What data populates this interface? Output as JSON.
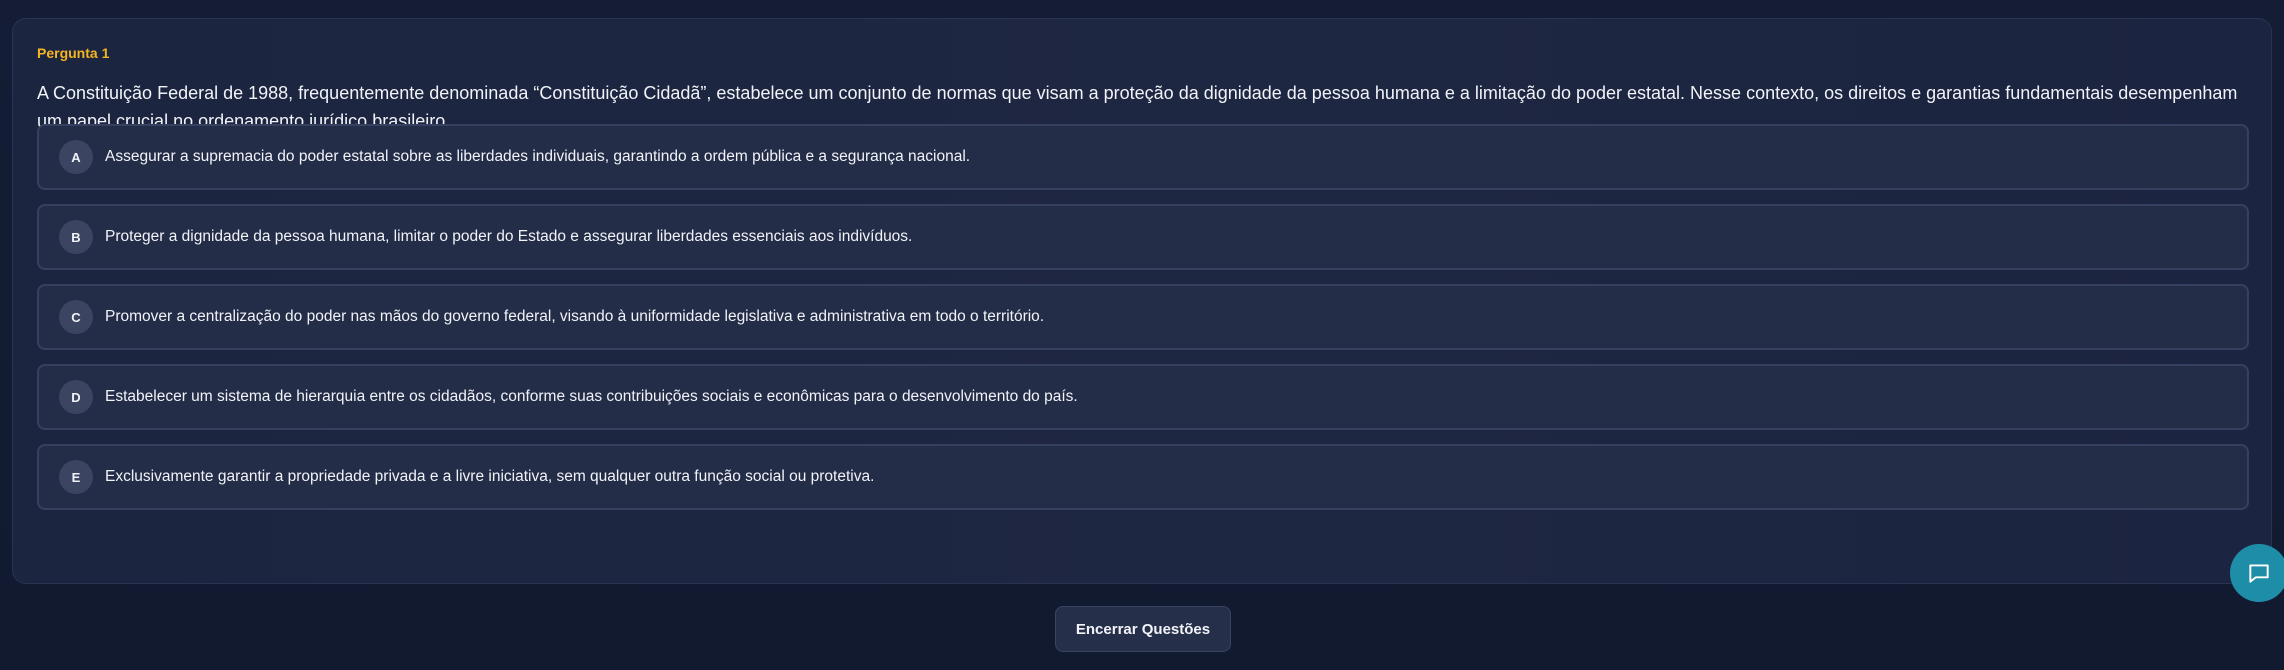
{
  "question": {
    "label": "Pergunta 1",
    "text": "A Constituição Federal de 1988, frequentemente denominada “Constituição Cidadã”, estabelece um conjunto de normas que visam a proteção da dignidade da pessoa humana e a limitação do poder estatal. Nesse contexto, os direitos e garantias fundamentais desempenham um papel crucial no ordenamento jurídico brasileiro."
  },
  "options": [
    {
      "letter": "A",
      "text": "Assegurar a supremacia do poder estatal sobre as liberdades individuais, garantindo a ordem pública e a segurança nacional."
    },
    {
      "letter": "B",
      "text": "Proteger a dignidade da pessoa humana, limitar o poder do Estado e assegurar liberdades essenciais aos indivíduos."
    },
    {
      "letter": "C",
      "text": "Promover a centralização do poder nas mãos do governo federal, visando à uniformidade legislativa e administrativa em todo o território."
    },
    {
      "letter": "D",
      "text": "Estabelecer um sistema de hierarquia entre os cidadãos, conforme suas contribuições sociais e econômicas para o desenvolvimento do país."
    },
    {
      "letter": "E",
      "text": "Exclusivamente garantir a propriedade privada e a livre iniciativa, sem qualquer outra função social ou protetiva."
    }
  ],
  "footer": {
    "finish_label": "Encerrar Questões"
  },
  "icons": {
    "chat": "chat-bubble-icon"
  },
  "colors": {
    "accent_label": "#f5b422",
    "chat_button": "#1e8ea8"
  }
}
